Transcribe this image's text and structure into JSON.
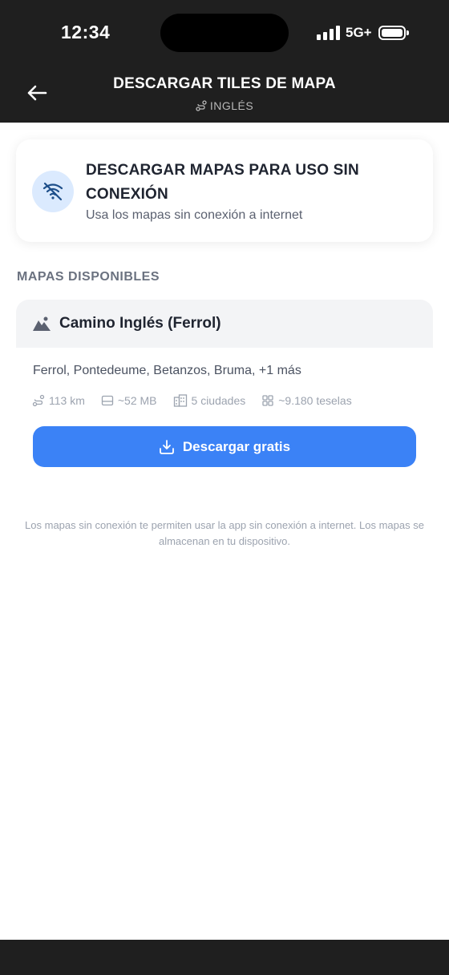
{
  "status": {
    "time": "12:34",
    "network": "5G+"
  },
  "header": {
    "title": "DESCARGAR TILES DE MAPA",
    "subtitle": "INGLÉS"
  },
  "offline_card": {
    "title": "DESCARGAR MAPAS PARA USO SIN CONEXIÓN",
    "subtitle": "Usa los mapas sin conexión a internet"
  },
  "section_label": "MAPAS DISPONIBLES",
  "route": {
    "name": "Camino Inglés (Ferrol)",
    "cities": "Ferrol, Pontedeume, Betanzos, Bruma, +1 más",
    "distance": "113 km",
    "size": "~52 MB",
    "city_count": "5 ciudades",
    "tiles": "~9.180 teselas",
    "download_label": "Descargar gratis"
  },
  "footnote": "Los mapas sin conexión te permiten usar la app sin conexión a internet. Los mapas se almacenan en tu dispositivo.",
  "colors": {
    "accent": "#3b82f6",
    "header_bg": "#1f1f1f",
    "icon_bg": "#dbeafe"
  }
}
